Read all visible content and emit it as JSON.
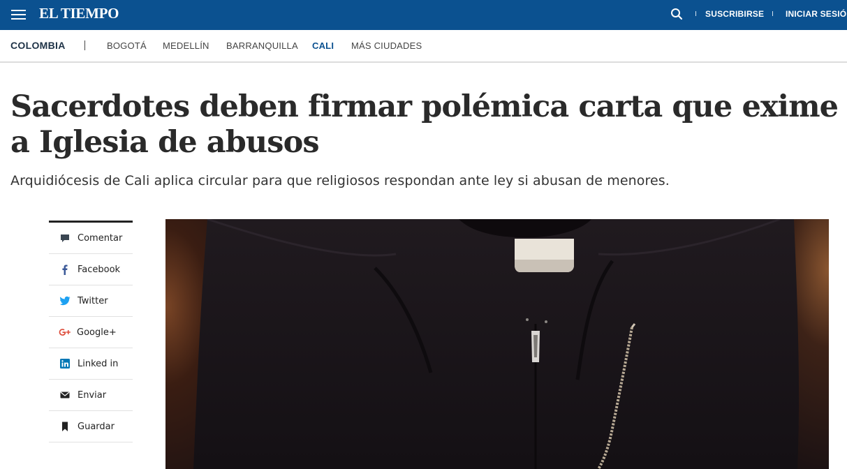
{
  "topbar": {
    "logo": "EL TIEMPO",
    "subscribe": "SUSCRIBIRSE",
    "login": "INICIAR SESIÓN",
    "background_color": "#0b5190",
    "menu_icon": "hamburger-menu-icon",
    "search_icon": "search-icon"
  },
  "section_nav": {
    "home": "COLOMBIA",
    "cities": [
      {
        "label": "BOGOTÁ",
        "active": false
      },
      {
        "label": "MEDELLÍN",
        "active": false
      },
      {
        "label": "BARRANQUILLA",
        "active": false
      },
      {
        "label": "CALI",
        "active": true
      },
      {
        "label": "MÁS CIUDADES",
        "active": false
      }
    ]
  },
  "article": {
    "headline": "Sacerdotes deben firmar polémica carta que exime a Iglesia de abusos",
    "subtitle": "Arquidiócesis de Cali aplica circular para que religiosos respondan ante ley si abusan de menores."
  },
  "share": {
    "items": [
      {
        "label": "Comentar",
        "icon": "comment-icon"
      },
      {
        "label": "Facebook",
        "icon": "facebook-icon",
        "color": "#3b5998"
      },
      {
        "label": "Twitter",
        "icon": "twitter-icon",
        "color": "#1da1f2"
      },
      {
        "label": "Google+",
        "icon": "google-plus-icon",
        "color": "#dd4b39"
      },
      {
        "label": "Linked in",
        "icon": "linkedin-icon",
        "color": "#0077b5"
      },
      {
        "label": "Enviar",
        "icon": "envelope-icon"
      },
      {
        "label": "Guardar",
        "icon": "bookmark-icon"
      }
    ]
  }
}
